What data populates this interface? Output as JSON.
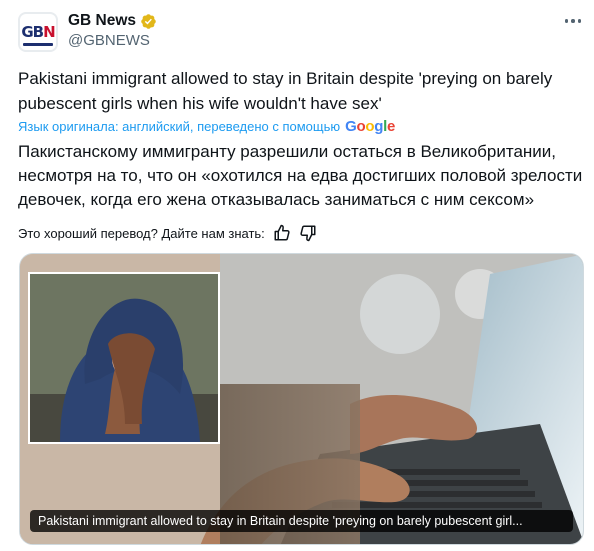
{
  "account": {
    "name": "GB News",
    "handle": "@GBNEWS",
    "verified_color": "#e2b719",
    "avatar_text": "GBN"
  },
  "tweet": {
    "original_text": "Pakistani immigrant allowed to stay in Britain despite 'preying on barely pubescent girls when his wife wouldn't have sex'",
    "translation_note": "Язык оригинала: английский, переведено с помощью",
    "translation_provider": "Google",
    "translated_text": "Пакистанскому иммигранту разрешили остаться в Великобритании, несмотря на то, что он «охотился на едва достигших половой зрелости девочек, когда его жена отказывалась заниматься с ним сексом»",
    "feedback_prompt": "Это хороший перевод? Дайте нам знать:"
  },
  "media": {
    "caption": "Pakistani immigrant allowed to stay in Britain despite 'preying on barely pubescent girl..."
  },
  "icons": {
    "more": "more-horizontal-icon",
    "verified": "verified-badge-icon",
    "thumbs_up": "thumbs-up-icon",
    "thumbs_down": "thumbs-down-icon"
  },
  "colors": {
    "link": "#1d9bf0",
    "text": "#0f1419",
    "secondary": "#536471"
  }
}
